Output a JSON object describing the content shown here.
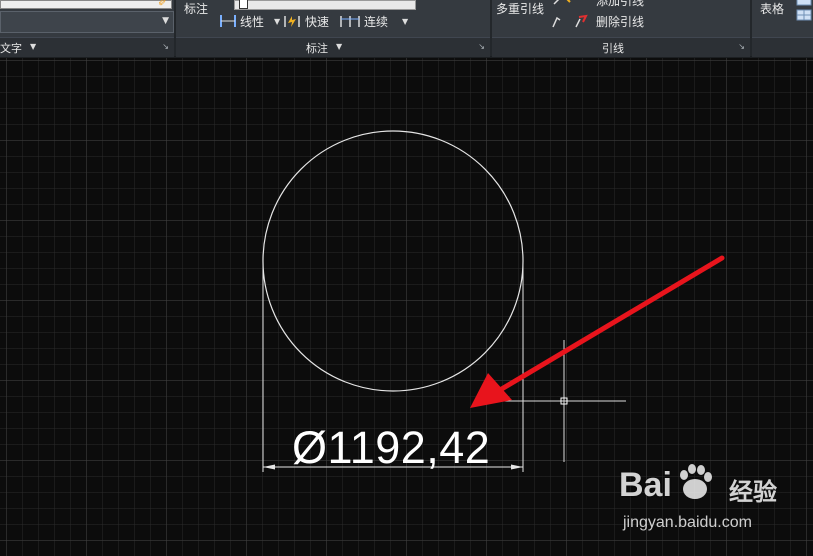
{
  "ribbon": {
    "text_panel": {
      "title": "文字"
    },
    "annotation_panel": {
      "side_label": "标注",
      "linear_label": "线性",
      "quick_label": "快速",
      "continue_label": "连续",
      "title": "标注"
    },
    "leader_panel": {
      "multileader_label": "多重引线",
      "add_leader_label": "添加引线",
      "remove_leader_label": "删除引线",
      "title": "引线"
    },
    "table_panel": {
      "label": "表格"
    }
  },
  "drawing": {
    "dimension_text": "Ø1192,42"
  },
  "watermark": {
    "logo_text": "Bai",
    "logo_suffix": "经验",
    "url": "jingyan.baidu.com"
  },
  "colors": {
    "ribbon_bg": "#353a40",
    "canvas_bg": "#0c0c0c",
    "drawing_line": "#e6e6e6",
    "annotation_arrow": "#e8141c"
  },
  "icons": [
    "text-style-icon",
    "dropdown-chevron-icon",
    "linear-dimension-icon",
    "quick-dimension-icon",
    "continue-dimension-icon",
    "add-leader-icon",
    "remove-leader-icon",
    "table-icon",
    "panel-launcher-icon"
  ]
}
